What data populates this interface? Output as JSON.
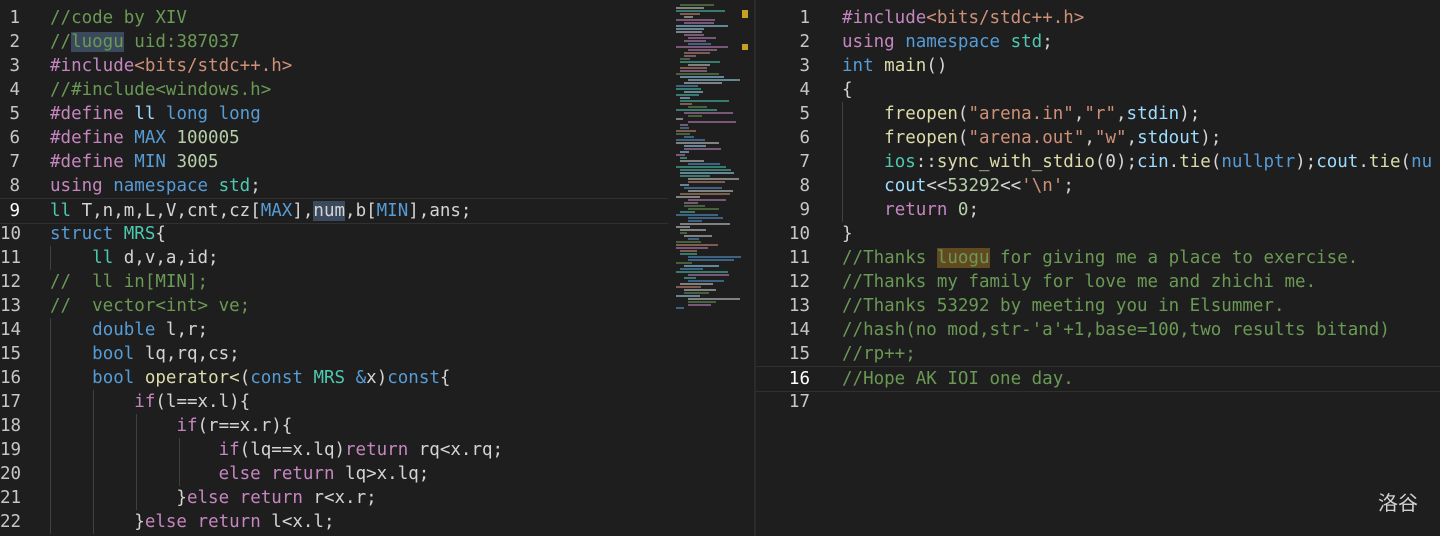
{
  "brand": "洛谷",
  "left_editor": {
    "lines": [
      {
        "n": "1",
        "tokens": [
          {
            "t": "//code by XIV",
            "c": "c"
          }
        ]
      },
      {
        "n": "2",
        "tokens": [
          {
            "t": "//",
            "c": "c"
          },
          {
            "t": "luogu",
            "c": "c hl"
          },
          {
            "t": " uid:387037",
            "c": "c"
          }
        ]
      },
      {
        "n": "3",
        "tokens": [
          {
            "t": "#include",
            "c": "p"
          },
          {
            "t": "<bits/stdc++.h>",
            "c": "s"
          }
        ]
      },
      {
        "n": "4",
        "tokens": [
          {
            "t": "//#include<windows.h>",
            "c": "c"
          }
        ]
      },
      {
        "n": "5",
        "tokens": [
          {
            "t": "#define",
            "c": "p"
          },
          {
            "t": " ll ",
            "c": "v"
          },
          {
            "t": "long long",
            "c": "k"
          }
        ]
      },
      {
        "n": "6",
        "tokens": [
          {
            "t": "#define",
            "c": "p"
          },
          {
            "t": " MAX ",
            "c": "k"
          },
          {
            "t": "100005",
            "c": "n"
          }
        ]
      },
      {
        "n": "7",
        "tokens": [
          {
            "t": "#define",
            "c": "p"
          },
          {
            "t": " MIN ",
            "c": "k"
          },
          {
            "t": "3005",
            "c": "n"
          }
        ]
      },
      {
        "n": "8",
        "tokens": [
          {
            "t": "using",
            "c": "p"
          },
          {
            "t": " "
          },
          {
            "t": "namespace",
            "c": "k"
          },
          {
            "t": " std",
            "c": "t"
          },
          {
            "t": ";"
          }
        ]
      },
      {
        "n": "9",
        "current": true,
        "tokens": [
          {
            "t": "ll",
            "c": "t"
          },
          {
            "t": " T,n,m,L,V,cnt,cz["
          },
          {
            "t": "MAX",
            "c": "k"
          },
          {
            "t": "],"
          },
          {
            "t": "num",
            "c": "hl"
          },
          {
            "t": ",b["
          },
          {
            "t": "MIN",
            "c": "k"
          },
          {
            "t": "],ans;"
          }
        ]
      },
      {
        "n": "10",
        "tokens": [
          {
            "t": "struct",
            "c": "k"
          },
          {
            "t": " MRS",
            "c": "t"
          },
          {
            "t": "{"
          }
        ]
      },
      {
        "n": "11",
        "indent": 1,
        "tokens": [
          {
            "t": "    "
          },
          {
            "t": "ll",
            "c": "t"
          },
          {
            "t": " d,v,a,id;"
          }
        ]
      },
      {
        "n": "12",
        "tokens": [
          {
            "t": "//  ll in[MIN];",
            "c": "c"
          }
        ]
      },
      {
        "n": "13",
        "tokens": [
          {
            "t": "//  vector<int> ve;",
            "c": "c"
          }
        ]
      },
      {
        "n": "14",
        "indent": 1,
        "tokens": [
          {
            "t": "    "
          },
          {
            "t": "double",
            "c": "k"
          },
          {
            "t": " l,r;"
          }
        ]
      },
      {
        "n": "15",
        "indent": 1,
        "tokens": [
          {
            "t": "    "
          },
          {
            "t": "bool",
            "c": "k"
          },
          {
            "t": " lq,rq,cs;"
          }
        ]
      },
      {
        "n": "16",
        "indent": 1,
        "tokens": [
          {
            "t": "    "
          },
          {
            "t": "bool",
            "c": "k"
          },
          {
            "t": " "
          },
          {
            "t": "operator<",
            "c": "f"
          },
          {
            "t": "("
          },
          {
            "t": "const",
            "c": "k"
          },
          {
            "t": " MRS ",
            "c": "t"
          },
          {
            "t": "&",
            "c": "k"
          },
          {
            "t": "x)"
          },
          {
            "t": "const",
            "c": "k"
          },
          {
            "t": "{"
          }
        ]
      },
      {
        "n": "17",
        "indent": 2,
        "tokens": [
          {
            "t": "        "
          },
          {
            "t": "if",
            "c": "p"
          },
          {
            "t": "(l==x.l){"
          }
        ]
      },
      {
        "n": "18",
        "indent": 3,
        "tokens": [
          {
            "t": "            "
          },
          {
            "t": "if",
            "c": "p"
          },
          {
            "t": "(r==x.r){"
          }
        ]
      },
      {
        "n": "19",
        "indent": 4,
        "tokens": [
          {
            "t": "                "
          },
          {
            "t": "if",
            "c": "p"
          },
          {
            "t": "(lq==x.lq)"
          },
          {
            "t": "return",
            "c": "p"
          },
          {
            "t": " rq<x.rq;"
          }
        ]
      },
      {
        "n": "20",
        "indent": 4,
        "tokens": [
          {
            "t": "                "
          },
          {
            "t": "else",
            "c": "p"
          },
          {
            "t": " "
          },
          {
            "t": "return",
            "c": "p"
          },
          {
            "t": " lq>x.lq;"
          }
        ]
      },
      {
        "n": "21",
        "indent": 3,
        "tokens": [
          {
            "t": "            }"
          },
          {
            "t": "else",
            "c": "p"
          },
          {
            "t": " "
          },
          {
            "t": "return",
            "c": "p"
          },
          {
            "t": " r<x.r;"
          }
        ]
      },
      {
        "n": "22",
        "indent": 2,
        "tokens": [
          {
            "t": "        }"
          },
          {
            "t": "else",
            "c": "p"
          },
          {
            "t": " "
          },
          {
            "t": "return",
            "c": "p"
          },
          {
            "t": " l<x.l;"
          }
        ]
      }
    ]
  },
  "right_editor": {
    "lines": [
      {
        "n": "1",
        "tokens": [
          {
            "t": "#include",
            "c": "p"
          },
          {
            "t": "<bits/stdc++.h>",
            "c": "s"
          }
        ]
      },
      {
        "n": "2",
        "tokens": [
          {
            "t": "using",
            "c": "p"
          },
          {
            "t": " "
          },
          {
            "t": "namespace",
            "c": "k"
          },
          {
            "t": " std",
            "c": "t"
          },
          {
            "t": ";"
          }
        ]
      },
      {
        "n": "3",
        "tokens": [
          {
            "t": "int",
            "c": "k"
          },
          {
            "t": " "
          },
          {
            "t": "main",
            "c": "f"
          },
          {
            "t": "()"
          }
        ]
      },
      {
        "n": "4",
        "tokens": [
          {
            "t": "{"
          }
        ]
      },
      {
        "n": "5",
        "indent": 1,
        "tokens": [
          {
            "t": "    "
          },
          {
            "t": "freopen",
            "c": "f"
          },
          {
            "t": "("
          },
          {
            "t": "\"arena.in\"",
            "c": "s"
          },
          {
            "t": ","
          },
          {
            "t": "\"r\"",
            "c": "s"
          },
          {
            "t": ","
          },
          {
            "t": "stdin",
            "c": "v"
          },
          {
            "t": ");"
          }
        ]
      },
      {
        "n": "6",
        "indent": 1,
        "tokens": [
          {
            "t": "    "
          },
          {
            "t": "freopen",
            "c": "f"
          },
          {
            "t": "("
          },
          {
            "t": "\"arena.out\"",
            "c": "s"
          },
          {
            "t": ","
          },
          {
            "t": "\"w\"",
            "c": "s"
          },
          {
            "t": ","
          },
          {
            "t": "stdout",
            "c": "v"
          },
          {
            "t": ");"
          }
        ]
      },
      {
        "n": "7",
        "indent": 1,
        "tokens": [
          {
            "t": "    "
          },
          {
            "t": "ios",
            "c": "t"
          },
          {
            "t": "::"
          },
          {
            "t": "sync_with_stdio",
            "c": "f"
          },
          {
            "t": "(0);"
          },
          {
            "t": "cin",
            "c": "v"
          },
          {
            "t": "."
          },
          {
            "t": "tie",
            "c": "f"
          },
          {
            "t": "("
          },
          {
            "t": "nullptr",
            "c": "k"
          },
          {
            "t": ");"
          },
          {
            "t": "cout",
            "c": "v"
          },
          {
            "t": "."
          },
          {
            "t": "tie",
            "c": "f"
          },
          {
            "t": "("
          },
          {
            "t": "nu",
            "c": "k"
          }
        ]
      },
      {
        "n": "8",
        "indent": 1,
        "tokens": [
          {
            "t": "    "
          },
          {
            "t": "cout",
            "c": "v"
          },
          {
            "t": "<<"
          },
          {
            "t": "53292",
            "c": "n"
          },
          {
            "t": "<<"
          },
          {
            "t": "'\\n'",
            "c": "s"
          },
          {
            "t": ";"
          }
        ]
      },
      {
        "n": "9",
        "indent": 1,
        "tokens": [
          {
            "t": "    "
          },
          {
            "t": "return",
            "c": "p"
          },
          {
            "t": " "
          },
          {
            "t": "0",
            "c": "n"
          },
          {
            "t": ";"
          }
        ]
      },
      {
        "n": "10",
        "tokens": [
          {
            "t": "}"
          }
        ]
      },
      {
        "n": "11",
        "tokens": [
          {
            "t": "//Thanks ",
            "c": "c"
          },
          {
            "t": "luogu",
            "c": "c hl2"
          },
          {
            "t": " for giving me a place to exercise.",
            "c": "c"
          }
        ]
      },
      {
        "n": "12",
        "tokens": [
          {
            "t": "//Thanks my family for love me and zhichi me.",
            "c": "c"
          }
        ]
      },
      {
        "n": "13",
        "tokens": [
          {
            "t": "//Thanks 53292 by meeting you in Elsummer.",
            "c": "c"
          }
        ]
      },
      {
        "n": "14",
        "tokens": [
          {
            "t": "//hash(no mod,str-'a'+1,base=100,two results bitand)",
            "c": "c"
          }
        ]
      },
      {
        "n": "15",
        "tokens": [
          {
            "t": "//rp++;",
            "c": "c"
          }
        ]
      },
      {
        "n": "16",
        "current": true,
        "tokens": [
          {
            "t": "//Hope AK IOI one day.",
            "c": "c"
          }
        ]
      },
      {
        "n": "17",
        "tokens": []
      }
    ]
  },
  "colors": {
    "background": "#1e1e1e",
    "comment": "#6a9955",
    "preprocessor": "#c586c0",
    "string": "#ce9178",
    "keyword": "#569cd6",
    "type": "#4ec9b0",
    "number": "#b5cea8",
    "function": "#dcdcaa"
  }
}
